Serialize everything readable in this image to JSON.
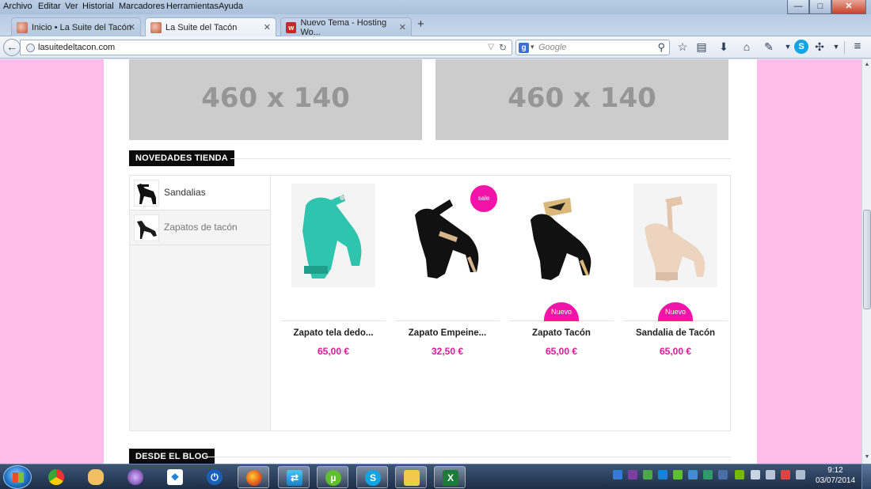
{
  "menubar": {
    "items": [
      "Archivo",
      "Editar",
      "Ver",
      "Historial",
      "Marcadores",
      "Herramientas",
      "Ayuda"
    ]
  },
  "tabs": [
    {
      "label": "Inicio • La Suite del Tacón",
      "active": false
    },
    {
      "label": "La Suite del Tacón",
      "active": true
    },
    {
      "label": "Nuevo Tema - Hosting Wo...",
      "active": false
    }
  ],
  "navbar": {
    "url": "lasuitedeltacon.com",
    "search_placeholder": "Google"
  },
  "banners": [
    "460 x 140",
    "460 x 140"
  ],
  "shop": {
    "title": "NOVEDADES TIENDA",
    "categories": [
      {
        "label": "Sandalias",
        "active": true
      },
      {
        "label": "Zapatos de tacón",
        "active": false
      }
    ],
    "products": [
      {
        "name": "Zapato tela dedo...",
        "price": "65,00 €",
        "badge": "",
        "color": "#2ec4ae"
      },
      {
        "name": "Zapato Empeine...",
        "price": "32,50 €",
        "badge": "sale",
        "color": "#141414"
      },
      {
        "name": "Zapato Tacón",
        "price": "65,00 €",
        "badge": "Nuevo",
        "color": "#141414"
      },
      {
        "name": "Sandalia de Tacón",
        "price": "65,00 €",
        "badge": "Nuevo",
        "color": "#ecd4bf"
      }
    ]
  },
  "blog": {
    "title": "DESDE EL BLOG"
  },
  "taskbar": {
    "time": "9:12",
    "date": "03/07/2014"
  },
  "colors": {
    "page_bg": "#fdbcea",
    "accent": "#e0199a",
    "badge": "#f213a8"
  }
}
